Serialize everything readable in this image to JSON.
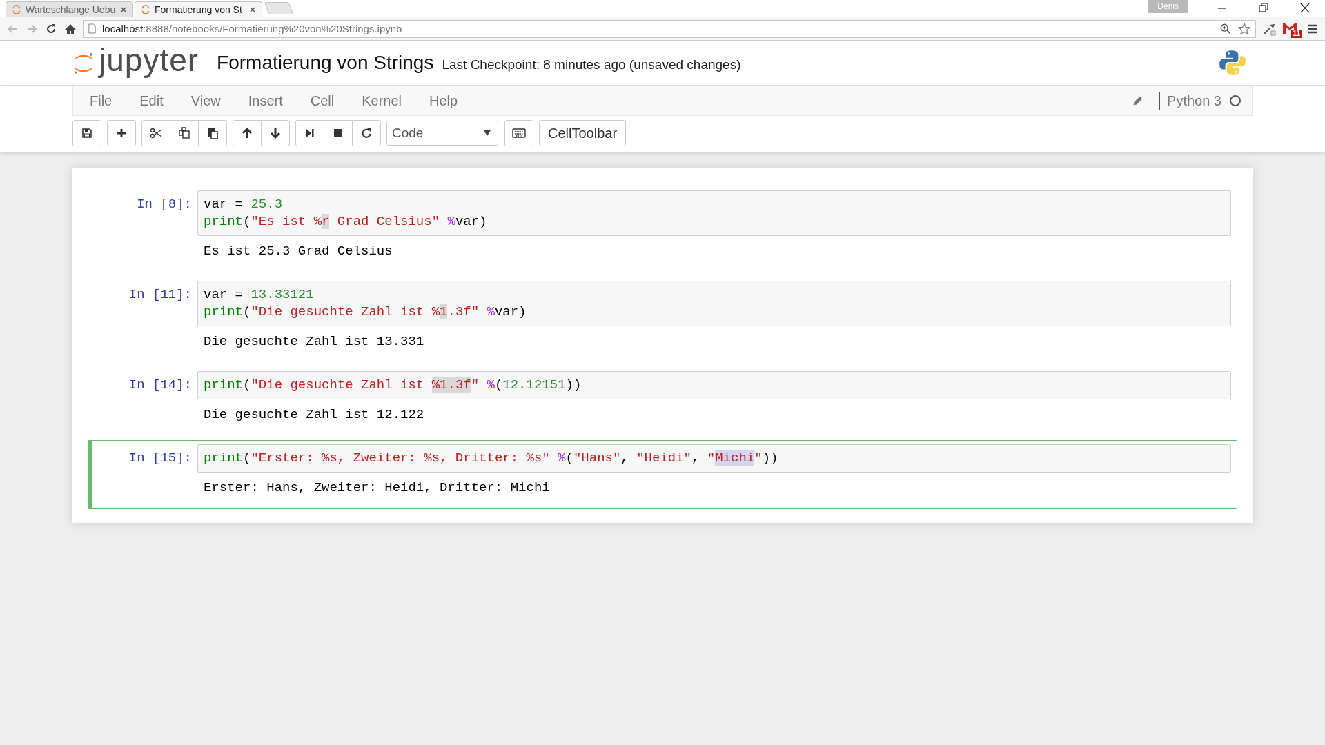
{
  "browser": {
    "tabs": [
      {
        "title": "Warteschlange Uebu",
        "selected": false
      },
      {
        "title": "Formatierung von St",
        "selected": true
      }
    ],
    "profile": "Denis",
    "url_host": "localhost",
    "url_path": ":8888/notebooks/Formatierung%20von%20Strings.ipynb",
    "mail_badge": "11"
  },
  "notebook": {
    "logo_text": "jupyter",
    "title": "Formatierung von Strings",
    "checkpoint": "Last Checkpoint: 8 minutes ago (unsaved changes)",
    "menu": [
      "File",
      "Edit",
      "View",
      "Insert",
      "Cell",
      "Kernel",
      "Help"
    ],
    "kernel": "Python 3",
    "kernel_busy": false,
    "cell_type": "Code",
    "celltoolbar": "CellToolbar"
  },
  "cells": [
    {
      "prompt": "In [8]:",
      "selected": false,
      "lines": [
        [
          {
            "text": "var = ",
            "kind": "plain",
            "highlighted": false
          },
          {
            "text": "25.3",
            "kind": "number",
            "highlighted": false
          }
        ],
        [
          {
            "text": "print",
            "kind": "builtin",
            "highlighted": false
          },
          {
            "text": "(",
            "kind": "plain",
            "highlighted": false
          },
          {
            "text": "\"Es ist %",
            "kind": "string",
            "highlighted": false
          },
          {
            "text": "r",
            "kind": "string",
            "highlighted": true
          },
          {
            "text": " Grad Celsius\"",
            "kind": "string",
            "highlighted": false
          },
          {
            "text": " %",
            "kind": "operator",
            "highlighted": false
          },
          {
            "text": "var)",
            "kind": "plain",
            "highlighted": false
          }
        ]
      ],
      "output": "Es ist 25.3 Grad Celsius"
    },
    {
      "prompt": "In [11]:",
      "selected": false,
      "lines": [
        [
          {
            "text": "var = ",
            "kind": "plain",
            "highlighted": false
          },
          {
            "text": "13.33121",
            "kind": "number",
            "highlighted": false
          }
        ],
        [
          {
            "text": "print",
            "kind": "builtin",
            "highlighted": false
          },
          {
            "text": "(",
            "kind": "plain",
            "highlighted": false
          },
          {
            "text": "\"Die gesuchte Zahl ist %",
            "kind": "string",
            "highlighted": false
          },
          {
            "text": "1",
            "kind": "string",
            "highlighted": true
          },
          {
            "text": ".3f\"",
            "kind": "string",
            "highlighted": false
          },
          {
            "text": " %",
            "kind": "operator",
            "highlighted": false
          },
          {
            "text": "var)",
            "kind": "plain",
            "highlighted": false
          }
        ]
      ],
      "output": "Die gesuchte Zahl ist 13.331"
    },
    {
      "prompt": "In [14]:",
      "selected": false,
      "lines": [
        [
          {
            "text": "print",
            "kind": "builtin",
            "highlighted": false
          },
          {
            "text": "(",
            "kind": "plain",
            "highlighted": false
          },
          {
            "text": "\"Die gesuchte Zahl ist ",
            "kind": "string",
            "highlighted": false
          },
          {
            "text": "%1.3f",
            "kind": "string",
            "highlighted": true
          },
          {
            "text": "\"",
            "kind": "string",
            "highlighted": false
          },
          {
            "text": " %",
            "kind": "operator",
            "highlighted": false
          },
          {
            "text": "(",
            "kind": "plain",
            "highlighted": false
          },
          {
            "text": "12.12151",
            "kind": "number",
            "highlighted": false
          },
          {
            "text": "))",
            "kind": "plain",
            "highlighted": false
          }
        ]
      ],
      "output": "Die gesuchte Zahl ist 12.122"
    },
    {
      "prompt": "In [15]:",
      "selected": true,
      "lines": [
        [
          {
            "text": "print",
            "kind": "builtin",
            "highlighted": false
          },
          {
            "text": "(",
            "kind": "plain",
            "highlighted": false
          },
          {
            "text": "\"Erster: %s, Zweiter: %s, Dritter: %s\"",
            "kind": "string",
            "highlighted": false
          },
          {
            "text": " %",
            "kind": "operator",
            "highlighted": false
          },
          {
            "text": "(",
            "kind": "plain",
            "highlighted": false
          },
          {
            "text": "\"Hans\"",
            "kind": "string",
            "highlighted": false
          },
          {
            "text": ", ",
            "kind": "plain",
            "highlighted": false
          },
          {
            "text": "\"Heidi\"",
            "kind": "string",
            "highlighted": false
          },
          {
            "text": ", ",
            "kind": "plain",
            "highlighted": false
          },
          {
            "text": "\"",
            "kind": "string",
            "highlighted": false
          },
          {
            "text": "Michi",
            "kind": "string",
            "highlighted": true
          },
          {
            "text": "\"",
            "kind": "string",
            "highlighted": false
          },
          {
            "text": "))",
            "kind": "plain",
            "highlighted": false
          }
        ]
      ],
      "output": "Erster: Hans, Zweiter: Heidi, Dritter: Michi"
    }
  ]
}
